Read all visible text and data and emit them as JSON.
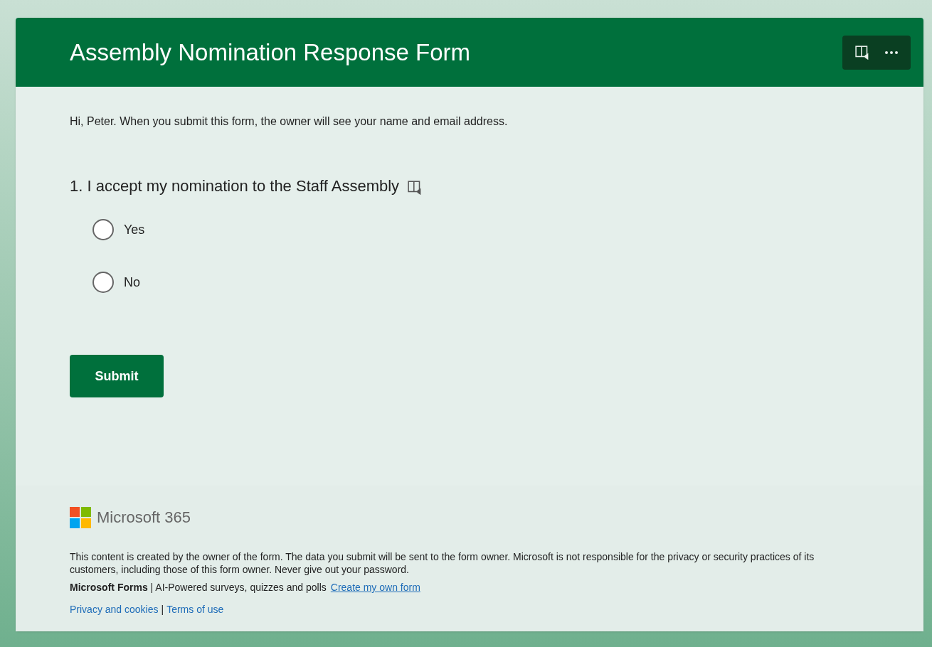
{
  "header": {
    "title": "Assembly Nomination Response Form"
  },
  "notice": "Hi, Peter. When you submit this form, the owner will see your name and email address.",
  "question": {
    "number": "1.",
    "text": "I accept my nomination to the Staff Assembly",
    "options": [
      {
        "label": "Yes",
        "selected": false
      },
      {
        "label": "No",
        "selected": false
      }
    ]
  },
  "submit": "Submit",
  "footer": {
    "brand": "Microsoft 365",
    "disclaimer": "This content is created by the owner of the form. The data you submit will be sent to the form owner. Microsoft is not responsible for the privacy or security practices of its customers, including those of this form owner. Never give out your password.",
    "product": "**Microsoft Forms** | AI-Powered surveys, quizzes and polls",
    "create_link": "Create my own form",
    "privacy_link": "Privacy and cookies",
    "separator": "|",
    "terms_link": "Terms of use"
  }
}
